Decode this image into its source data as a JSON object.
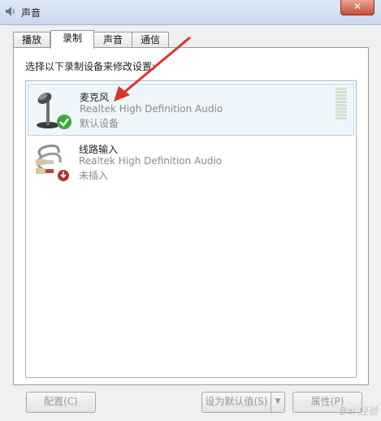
{
  "window": {
    "title": "声音",
    "close_glyph": "✕"
  },
  "tabs": [
    {
      "label": "播放",
      "active": false
    },
    {
      "label": "录制",
      "active": true
    },
    {
      "label": "声音",
      "active": false
    },
    {
      "label": "通信",
      "active": false
    }
  ],
  "panel": {
    "instruction": "选择以下录制设备来修改设置:"
  },
  "devices": [
    {
      "name": "麦克风",
      "driver": "Realtek High Definition Audio",
      "status": "默认设备",
      "icon": "microphone-icon",
      "badge": "check-icon"
    },
    {
      "name": "线路输入",
      "driver": "Realtek High Definition Audio",
      "status": "未插入",
      "icon": "line-in-cable-icon",
      "badge": "unplugged-icon"
    }
  ],
  "buttons": {
    "configure": "配置(C)",
    "set_default": "设为默认值(S)",
    "dropdown_glyph": "▼",
    "properties": "属性(P)"
  },
  "watermark": "Bai 经验",
  "colors": {
    "accent_arrow": "#e0312a",
    "selected_bg": "#eef6fb",
    "default_check": "#3ca83c"
  }
}
